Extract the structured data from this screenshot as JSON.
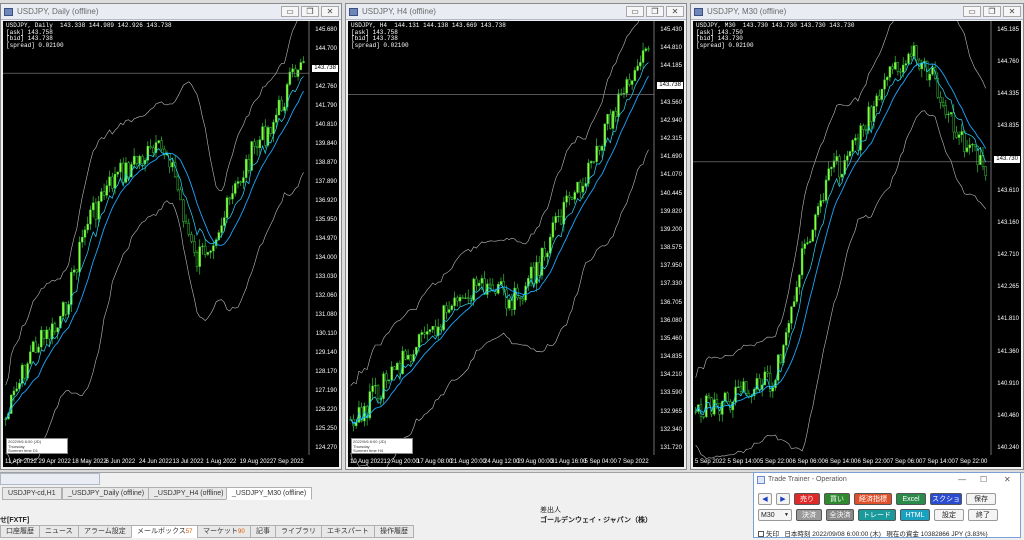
{
  "windows": [
    {
      "title": "USDJPY, Daily (offline)",
      "info": [
        "USDJPY, Daily  143.338 144.989 142.926 143.738",
        "[ask] 143.758",
        "[bid] 143.738",
        "[spread] 0.02100"
      ],
      "current_price": "143.738",
      "ylabels": [
        "145.680",
        "144.700",
        "143.738",
        "142.760",
        "141.790",
        "140.810",
        "139.840",
        "138.870",
        "137.890",
        "136.920",
        "135.950",
        "134.970",
        "134.000",
        "133.030",
        "132.060",
        "131.080",
        "130.110",
        "129.140",
        "128.170",
        "127.190",
        "126.220",
        "125.250",
        "124.270"
      ],
      "xlabels": [
        "11 Apr 2022",
        "29 Apr 2022",
        "18 May 2022",
        "6 Jun 2022",
        "24 Jun 2022",
        "13 Jul 2022",
        "1 Aug 2022",
        "19 Aug 2022",
        "7 Sep 2022"
      ],
      "minibox": [
        "2022/9/6 8:00 (JD)",
        "Thursday",
        "Summer time   D1"
      ]
    },
    {
      "title": "USDJPY, H4 (offline)",
      "info": [
        "USDJPY, H4  144.131 144.138 143.669 143.738",
        "[ask] 143.758",
        "[bid] 143.738",
        "[spread] 0.02100"
      ],
      "current_price": "143.738",
      "ylabels": [
        "145.430",
        "144.810",
        "144.185",
        "143.738",
        "143.560",
        "142.940",
        "142.315",
        "141.690",
        "141.070",
        "140.445",
        "139.820",
        "139.200",
        "138.575",
        "137.950",
        "137.330",
        "136.705",
        "136.080",
        "135.460",
        "134.835",
        "134.210",
        "133.590",
        "132.965",
        "132.340",
        "131.720"
      ],
      "xlabels": [
        "10 Aug 2022",
        "12 Aug 20:00",
        "17 Aug 08:00",
        "21 Aug 20:00",
        "24 Aug 12:00",
        "29 Aug 00:00",
        "31 Aug 16:00",
        "5 Sep 04:00",
        "7 Sep 2022"
      ],
      "minibox": [
        "2022/9/6 8:00 (JD)",
        "Thursday",
        "Summer time   H4"
      ]
    },
    {
      "title": "USDJPY, M30 (offline)",
      "info": [
        "USDJPY, M30  143.730 143.730 143.730 143.730",
        "[ask] 143.750",
        "[bid] 143.730",
        "[spread] 0.02100"
      ],
      "current_price": "143.730",
      "ylabels": [
        "145.185",
        "144.760",
        "144.335",
        "143.835",
        "143.730",
        "143.610",
        "143.160",
        "142.710",
        "142.265",
        "141.810",
        "141.360",
        "140.910",
        "140.460",
        "140.240"
      ],
      "xlabels": [
        "5 Sep 2022",
        "5 Sep 14:00",
        "5 Sep 22:00",
        "6 Sep 06:00",
        "6 Sep 14:00",
        "6 Sep 22:00",
        "7 Sep 06:00",
        "7 Sep 14:00",
        "7 Sep 22:00"
      ],
      "minibox": []
    }
  ],
  "chart_tabs": [
    "USDJPY-cd,H1",
    "_USDJPY_Daily (offline)",
    "_USDJPY_H4 (offline)",
    "_USDJPY_M30 (offline)"
  ],
  "terminal": {
    "col_sender": "差出人",
    "sender_value": "ゴールデンウェイ・ジャパン（株）",
    "left_label": "せ[FXTF]",
    "tabs": [
      "口座履歴",
      "ニュース",
      "アラーム設定",
      "メールボックス",
      "マーケット",
      "記事",
      "ライブラリ",
      "エキスパート",
      "操作履歴"
    ],
    "mailbox_count": "57",
    "market_count": "90"
  },
  "trade_trainer": {
    "title": "Trade Trainer - Operation",
    "row1": [
      "◀",
      "▶",
      "売り",
      "買い",
      "経済指標",
      "Excel",
      "スクショ",
      "保存"
    ],
    "row2_select": "M30",
    "row2": [
      "決済",
      "全決済",
      "トレード",
      "HTML",
      "設定",
      "終了"
    ],
    "status_checkbox": "矢印",
    "status_time": "日本時刻 2022/09/08 6:00:00 (木)",
    "status_balance": "現在の資金 10382866 JPY (3.83%)",
    "colors": {
      "sell": "#e02a2a",
      "buy": "#2f8a2f",
      "econ": "#e0502a",
      "excel": "#2a8a4a",
      "screenshot": "#2a4ad0",
      "close": "#9a9a9a",
      "closeall": "#8a8a8a",
      "trade": "#1a9a9a",
      "html": "#1aa0c0"
    }
  }
}
